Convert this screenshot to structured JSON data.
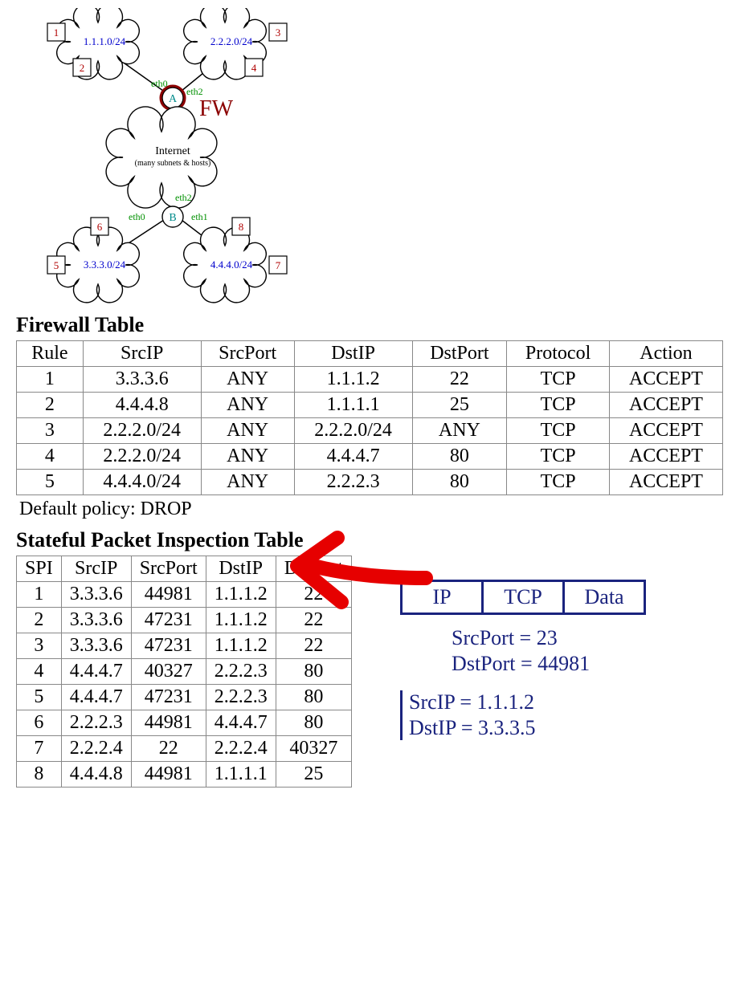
{
  "diagram": {
    "clouds": [
      {
        "id": "c1",
        "label": "1.1.1.0/24",
        "hosts": [
          "1",
          "2"
        ]
      },
      {
        "id": "c2",
        "label": "2.2.2.0/24",
        "hosts": [
          "3",
          "4"
        ]
      },
      {
        "id": "c3",
        "label": "3.3.3.0/24",
        "hosts": [
          "5",
          "6"
        ]
      },
      {
        "id": "c4",
        "label": "4.4.4.0/24",
        "hosts": [
          "7",
          "8"
        ]
      }
    ],
    "internet_label": "Internet",
    "internet_sub": "(many subnets & hosts)",
    "routers": [
      {
        "id": "A",
        "label": "A"
      },
      {
        "id": "B",
        "label": "B"
      }
    ],
    "iface": {
      "eth0": "eth0",
      "eth1": "eth1",
      "eth2": "eth2"
    },
    "fw_annot": "FW"
  },
  "firewall": {
    "title": "Firewall Table",
    "headers": [
      "Rule",
      "SrcIP",
      "SrcPort",
      "DstIP",
      "DstPort",
      "Protocol",
      "Action"
    ],
    "rows": [
      [
        "1",
        "3.3.3.6",
        "ANY",
        "1.1.1.2",
        "22",
        "TCP",
        "ACCEPT"
      ],
      [
        "2",
        "4.4.4.8",
        "ANY",
        "1.1.1.1",
        "25",
        "TCP",
        "ACCEPT"
      ],
      [
        "3",
        "2.2.2.0/24",
        "ANY",
        "2.2.2.0/24",
        "ANY",
        "TCP",
        "ACCEPT"
      ],
      [
        "4",
        "2.2.2.0/24",
        "ANY",
        "4.4.4.7",
        "80",
        "TCP",
        "ACCEPT"
      ],
      [
        "5",
        "4.4.4.0/24",
        "ANY",
        "2.2.2.3",
        "80",
        "TCP",
        "ACCEPT"
      ]
    ],
    "policy": "Default policy: DROP"
  },
  "spi": {
    "title": "Stateful Packet Inspection Table",
    "headers": [
      "SPI",
      "SrcIP",
      "SrcPort",
      "DstIP",
      "DstPort"
    ],
    "rows": [
      [
        "1",
        "3.3.3.6",
        "44981",
        "1.1.1.2",
        "22"
      ],
      [
        "2",
        "3.3.3.6",
        "47231",
        "1.1.1.2",
        "22"
      ],
      [
        "3",
        "3.3.3.6",
        "47231",
        "1.1.1.2",
        "22"
      ],
      [
        "4",
        "4.4.4.7",
        "40327",
        "2.2.2.3",
        "80"
      ],
      [
        "5",
        "4.4.4.7",
        "47231",
        "2.2.2.3",
        "80"
      ],
      [
        "6",
        "2.2.2.3",
        "44981",
        "4.4.4.7",
        "80"
      ],
      [
        "7",
        "2.2.2.4",
        "22",
        "2.2.2.4",
        "40327"
      ],
      [
        "8",
        "4.4.4.8",
        "44981",
        "1.1.1.1",
        "25"
      ]
    ]
  },
  "packet": {
    "segments": [
      "IP",
      "TCP",
      "Data"
    ],
    "notes": {
      "srcport": "SrcPort = 23",
      "dstport": "DstPort = 44981",
      "srcip": "SrcIP = 1.1.1.2",
      "dstip": "DstIP = 3.3.3.5"
    }
  },
  "chart_data": {
    "type": "table",
    "tables": [
      {
        "title": "Firewall Table",
        "default_policy": "DROP",
        "columns": [
          "Rule",
          "SrcIP",
          "SrcPort",
          "DstIP",
          "DstPort",
          "Protocol",
          "Action"
        ],
        "rows": [
          [
            1,
            "3.3.3.6",
            "ANY",
            "1.1.1.2",
            22,
            "TCP",
            "ACCEPT"
          ],
          [
            2,
            "4.4.4.8",
            "ANY",
            "1.1.1.1",
            25,
            "TCP",
            "ACCEPT"
          ],
          [
            3,
            "2.2.2.0/24",
            "ANY",
            "2.2.2.0/24",
            "ANY",
            "TCP",
            "ACCEPT"
          ],
          [
            4,
            "2.2.2.0/24",
            "ANY",
            "4.4.4.7",
            80,
            "TCP",
            "ACCEPT"
          ],
          [
            5,
            "4.4.4.0/24",
            "ANY",
            "2.2.2.3",
            80,
            "TCP",
            "ACCEPT"
          ]
        ]
      },
      {
        "title": "Stateful Packet Inspection Table",
        "columns": [
          "SPI",
          "SrcIP",
          "SrcPort",
          "DstIP",
          "DstPort"
        ],
        "rows": [
          [
            1,
            "3.3.3.6",
            44981,
            "1.1.1.2",
            22
          ],
          [
            2,
            "3.3.3.6",
            47231,
            "1.1.1.2",
            22
          ],
          [
            3,
            "3.3.3.6",
            47231,
            "1.1.1.2",
            22
          ],
          [
            4,
            "4.4.4.7",
            40327,
            "2.2.2.3",
            80
          ],
          [
            5,
            "4.4.4.7",
            47231,
            "2.2.2.3",
            80
          ],
          [
            6,
            "2.2.2.3",
            44981,
            "4.4.4.7",
            80
          ],
          [
            7,
            "2.2.2.4",
            22,
            "2.2.2.4",
            40327
          ],
          [
            8,
            "4.4.4.8",
            44981,
            "1.1.1.1",
            25
          ]
        ]
      }
    ],
    "topology": {
      "routers": [
        "A",
        "B"
      ],
      "subnets": {
        "1.1.1.0/24": {
          "router": "A",
          "iface": "eth0",
          "hosts": [
            1,
            2
          ]
        },
        "2.2.2.0/24": {
          "router": "A",
          "iface": "eth2",
          "hosts": [
            3,
            4
          ]
        },
        "Internet": {
          "between": [
            "A",
            "B"
          ],
          "A_iface": "eth1",
          "B_iface": "eth2"
        },
        "3.3.3.0/24": {
          "router": "B",
          "iface": "eth0",
          "hosts": [
            5,
            6
          ]
        },
        "4.4.4.0/24": {
          "router": "B",
          "iface": "eth1",
          "hosts": [
            7,
            8
          ]
        }
      },
      "firewall_at": "A"
    },
    "example_packet": {
      "layers": [
        "IP",
        "TCP",
        "Data"
      ],
      "SrcIP": "1.1.1.2",
      "DstIP": "3.3.3.5",
      "SrcPort": 23,
      "DstPort": 44981
    }
  }
}
